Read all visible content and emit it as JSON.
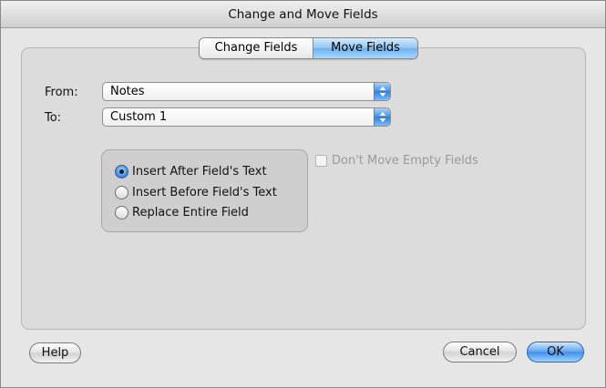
{
  "window": {
    "title": "Change and Move Fields"
  },
  "tabs": [
    {
      "label": "Change Fields",
      "selected": false
    },
    {
      "label": "Move Fields",
      "selected": true
    }
  ],
  "form": {
    "from_label": "From:",
    "from_value": "Notes",
    "to_label": "To:",
    "to_value": "Custom 1"
  },
  "options": {
    "radios": [
      {
        "label": "Insert After Field's Text",
        "selected": true
      },
      {
        "label": "Insert Before Field's Text",
        "selected": false
      },
      {
        "label": "Replace Entire Field",
        "selected": false
      }
    ],
    "checkbox": {
      "label": "Don't Move Empty Fields",
      "checked": false,
      "enabled": false
    }
  },
  "buttons": {
    "help": "Help",
    "cancel": "Cancel",
    "ok": "OK"
  },
  "colors": {
    "accent": "#3f8ee9",
    "window_bg": "#e6e6e6",
    "disabled_text": "#9a9a9a"
  }
}
